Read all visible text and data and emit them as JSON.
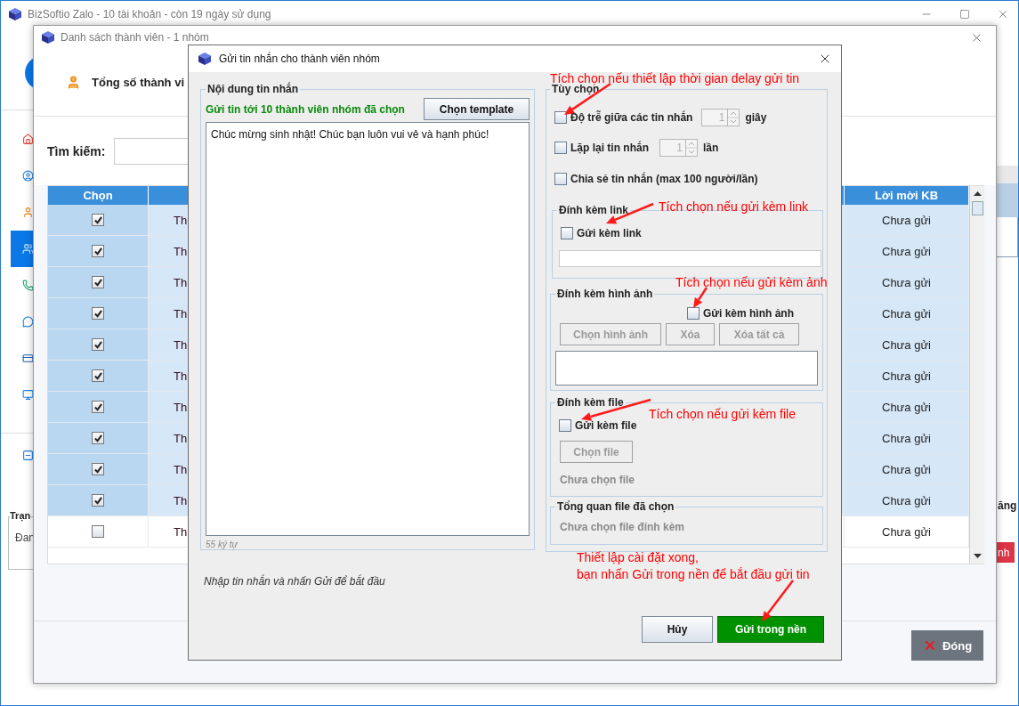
{
  "app_window": {
    "title": "BizSoftio Zalo - 10 tài khoản - còn 19 ngày sử dụng",
    "sidebar": {
      "items": [
        {
          "selected": false
        },
        {
          "selected": false
        },
        {
          "selected": false
        },
        {
          "selected": true
        },
        {
          "selected": false
        },
        {
          "selected": false
        },
        {
          "selected": false
        },
        {
          "selected": false
        }
      ],
      "bottom_items": [
        {
          "selected": false
        }
      ]
    },
    "status_group": {
      "legend": "Trạn",
      "text": "Đan"
    },
    "right_label": "ăng",
    "right_button": "nh"
  },
  "members_dialog": {
    "title": "Danh sách thành viên - 1 nhóm",
    "total_label": "Tổng số thành vi",
    "search_label": "Tìm kiếm:",
    "table": {
      "columns": [
        "Chọn",
        "Lời mời KB"
      ],
      "rows": [
        {
          "checked": true,
          "column_2": "Th",
          "invite": "Chưa gửi"
        },
        {
          "checked": true,
          "column_2": "Th",
          "invite": "Chưa gửi"
        },
        {
          "checked": true,
          "column_2": "Th",
          "invite": "Chưa gửi"
        },
        {
          "checked": true,
          "column_2": "Th",
          "invite": "Chưa gửi"
        },
        {
          "checked": true,
          "column_2": "Th",
          "invite": "Chưa gửi"
        },
        {
          "checked": true,
          "column_2": "Th",
          "invite": "Chưa gửi"
        },
        {
          "checked": true,
          "column_2": "Th",
          "invite": "Chưa gửi"
        },
        {
          "checked": true,
          "column_2": "Th",
          "invite": "Chưa gửi"
        },
        {
          "checked": true,
          "column_2": "Th",
          "invite": "Chưa gửi"
        },
        {
          "checked": true,
          "column_2": "Th",
          "invite": "Chưa gửi"
        },
        {
          "checked": false,
          "column_2": "Th",
          "invite": "Chưa gửi"
        }
      ]
    },
    "close_button": "Đóng"
  },
  "send_dialog": {
    "title": "Gửi tin nhắn cho thành viên nhóm",
    "message_group": {
      "legend": "Nội dung tin nhắn",
      "recipients": "Gửi tin tới 10 thành viên nhóm đã chọn",
      "template_button": "Chọn template",
      "message": "Chúc mừng sinh nhật! Chúc bạn luôn vui vẻ và hạnh phúc!",
      "char_count": "55 ký tự"
    },
    "hint": "Nhập tin nhắn và nhấn Gửi để bắt đầu",
    "options": {
      "legend": "Tùy chọn",
      "delay": {
        "label": "Độ trễ giữa các tin nhắn",
        "checked": false,
        "value": "1",
        "disabled": true,
        "unit": "giây"
      },
      "repeat": {
        "label": "Lặp lại tin nhắn",
        "checked": false,
        "value": "1",
        "disabled": true,
        "unit": "lần"
      },
      "share": {
        "label": "Chia sẻ tin nhắn (max 100 người/lần)",
        "checked": false
      }
    },
    "link": {
      "legend": "Đính kèm link",
      "label": "Gửi kèm link",
      "checked": false
    },
    "image": {
      "legend": "Đính kèm hình ảnh",
      "label": "Gửi kèm hình ảnh",
      "checked": false,
      "buttons": [
        {
          "label": "Chọn hình ảnh",
          "disabled": true
        },
        {
          "label": "Xóa",
          "disabled": true
        },
        {
          "label": "Xóa tất cả",
          "disabled": true
        }
      ]
    },
    "file": {
      "legend": "Đính kèm file",
      "label": "Gửi kèm file",
      "checked": false,
      "button": {
        "label": "Chọn file",
        "disabled": true
      },
      "status": "Chưa chọn file"
    },
    "summary": {
      "legend": "Tổng quan file đã chọn",
      "text": "Chưa chọn file đính kèm"
    },
    "cancel_button": "Hủy",
    "send_button": "Gửi trong nền"
  },
  "annotations": [
    {
      "lines": [
        "Tích chọn nếu thiết lập thời gian delay gửi tin"
      ]
    },
    {
      "lines": [
        "Tích chọn nếu gửi kèm link"
      ]
    },
    {
      "lines": [
        "Tích chọn nếu gửi kèm ảnh"
      ]
    },
    {
      "lines": [
        "Tích chọn nếu gửi kèm file"
      ]
    },
    {
      "lines": [
        "Thiết lập cài đặt xong,",
        "bạn nhấn Gửi trong nền để bắt đầu gửi tin"
      ]
    }
  ]
}
